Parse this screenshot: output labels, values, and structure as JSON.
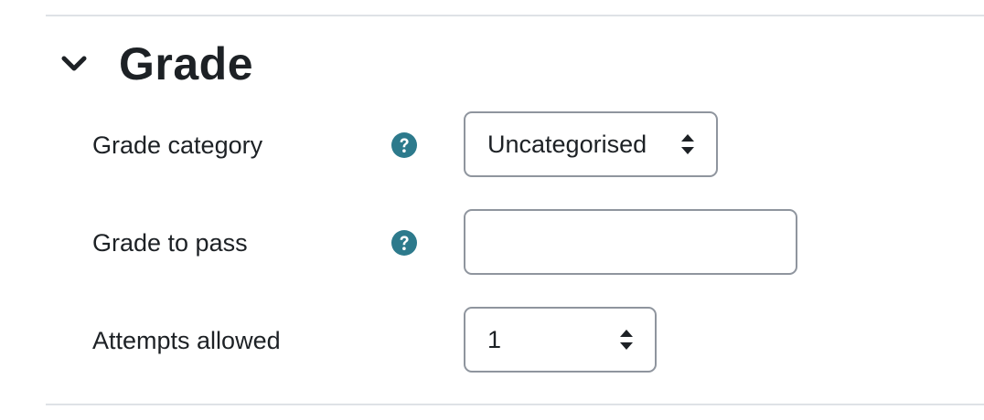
{
  "section": {
    "title": "Grade",
    "collapse_icon": "chevron-down-icon"
  },
  "fields": {
    "grade_category": {
      "label": "Grade category",
      "value": "Uncategorised",
      "help_icon": "question-circle-icon"
    },
    "grade_to_pass": {
      "label": "Grade to pass",
      "value": "",
      "help_icon": "question-circle-icon"
    },
    "attempts_allowed": {
      "label": "Attempts allowed",
      "value": "1"
    }
  },
  "colors": {
    "help_icon": "#2d7a8c",
    "border": "#8f959e",
    "divider": "#dee2e6",
    "text": "#1d2125"
  }
}
